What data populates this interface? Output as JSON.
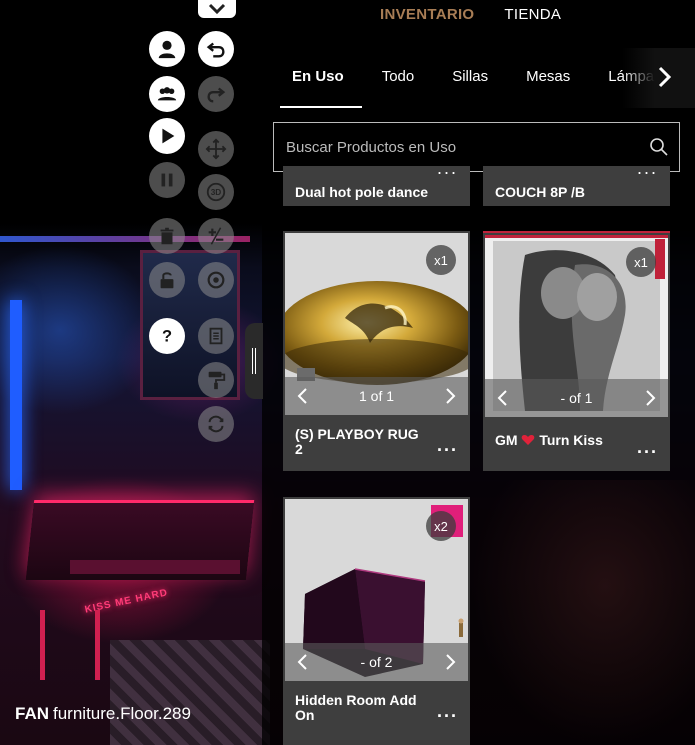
{
  "top_nav": {
    "inventory": "INVENTARIO",
    "store": "TIENDA"
  },
  "tabs": [
    "En Uso",
    "Todo",
    "Sillas",
    "Mesas",
    "Lámparas"
  ],
  "active_tab": "En Uso",
  "search": {
    "placeholder": "Buscar Productos en Uso",
    "value": ""
  },
  "partial_cards": [
    {
      "name": "Dual hot pole dance",
      "more": "..."
    },
    {
      "name": "COUCH 8P  /B",
      "more": "..."
    }
  ],
  "cards": [
    {
      "name": "(S) PLAYBOY RUG 2",
      "qty": "x1",
      "pager": "1 of 1",
      "more": "..."
    },
    {
      "name": "Turn Kiss",
      "name_prefix": "GM",
      "qty": "x1",
      "pager": "- of 1",
      "more": "..."
    },
    {
      "name": "Hidden Room Add On",
      "qty": "x2",
      "pager": "- of 2",
      "more": "..."
    }
  ],
  "selected_item": {
    "prefix": "FAN",
    "name": "furniture.Floor.289"
  },
  "toolbar_icons": [
    "chevron-down-icon",
    "user-icon",
    "undo-icon",
    "group-icon",
    "redo-icon",
    "play-icon",
    "move-icon",
    "pause-icon",
    "rotate-3d-icon",
    "trash-icon",
    "plus-minus-icon",
    "lock-icon",
    "rotate-icon",
    "help-icon",
    "layers-icon",
    "paint-roller-icon",
    "swap-icon"
  ],
  "colors": {
    "active_nav": "#a87d55",
    "card_bg": "#3e3e3e",
    "heart": "#e0223a"
  }
}
